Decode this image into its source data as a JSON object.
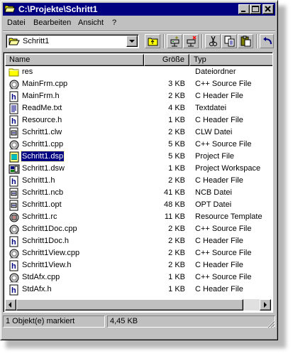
{
  "window": {
    "title": "C:\\Projekte\\Schritt1"
  },
  "menu": [
    {
      "label": "Datei"
    },
    {
      "label": "Bearbeiten"
    },
    {
      "label": "Ansicht"
    },
    {
      "label": "?"
    }
  ],
  "address": {
    "value": "Schritt1",
    "icon": "open-folder-icon"
  },
  "toolbar": {
    "buttons": [
      "up-one-level",
      "map-network-drive",
      "disconnect-network-drive",
      "cut",
      "copy",
      "paste",
      "undo"
    ]
  },
  "columns": {
    "name": "Name",
    "size": "Größe",
    "type": "Typ"
  },
  "files": [
    {
      "name": "res",
      "size": "",
      "type": "Dateiordner",
      "icon": "folder-icon"
    },
    {
      "name": "MainFrm.cpp",
      "size": "3 KB",
      "type": "C++ Source File",
      "icon": "cpp-file-icon"
    },
    {
      "name": "MainFrm.h",
      "size": "2 KB",
      "type": "C Header File",
      "icon": "header-file-icon"
    },
    {
      "name": "ReadMe.txt",
      "size": "4 KB",
      "type": "Textdatei",
      "icon": "text-file-icon"
    },
    {
      "name": "Resource.h",
      "size": "1 KB",
      "type": "C Header File",
      "icon": "header-file-icon"
    },
    {
      "name": "Schritt1.clw",
      "size": "2 KB",
      "type": "CLW Datei",
      "icon": "generic-file-icon"
    },
    {
      "name": "Schritt1.cpp",
      "size": "5 KB",
      "type": "C++ Source File",
      "icon": "cpp-file-icon"
    },
    {
      "name": "Schritt1.dsp",
      "size": "5 KB",
      "type": "Project File",
      "icon": "project-file-icon",
      "selected": true
    },
    {
      "name": "Schritt1.dsw",
      "size": "1 KB",
      "type": "Project Workspace",
      "icon": "workspace-file-icon"
    },
    {
      "name": "Schritt1.h",
      "size": "2 KB",
      "type": "C Header File",
      "icon": "header-file-icon"
    },
    {
      "name": "Schritt1.ncb",
      "size": "41 KB",
      "type": "NCB Datei",
      "icon": "generic-file-icon"
    },
    {
      "name": "Schritt1.opt",
      "size": "48 KB",
      "type": "OPT Datei",
      "icon": "generic-file-icon"
    },
    {
      "name": "Schritt1.rc",
      "size": "11 KB",
      "type": "Resource Template",
      "icon": "resource-file-icon"
    },
    {
      "name": "Schritt1Doc.cpp",
      "size": "2 KB",
      "type": "C++ Source File",
      "icon": "cpp-file-icon"
    },
    {
      "name": "Schritt1Doc.h",
      "size": "2 KB",
      "type": "C Header File",
      "icon": "header-file-icon"
    },
    {
      "name": "Schritt1View.cpp",
      "size": "2 KB",
      "type": "C++ Source File",
      "icon": "cpp-file-icon"
    },
    {
      "name": "Schritt1View.h",
      "size": "2 KB",
      "type": "C Header File",
      "icon": "header-file-icon"
    },
    {
      "name": "StdAfx.cpp",
      "size": "1 KB",
      "type": "C++ Source File",
      "icon": "cpp-file-icon"
    },
    {
      "name": "StdAfx.h",
      "size": "1 KB",
      "type": "C Header File",
      "icon": "header-file-icon"
    }
  ],
  "status": {
    "selection": "1 Objekt(e) markiert",
    "size": "4,45 KB"
  },
  "colors": {
    "titlebar": "#000080",
    "face": "#c0c0c0",
    "selection": "#000080"
  }
}
